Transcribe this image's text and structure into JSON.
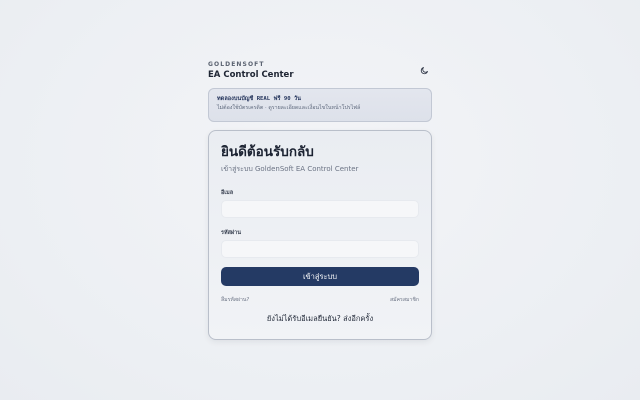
{
  "brand": {
    "company": "GOLDENSOFT",
    "app_name": "EA Control Center"
  },
  "header": {
    "theme_icon": "moon-icon"
  },
  "notice": {
    "title": "ทดลองบนบัญชี REAL ฟรี 90 วัน",
    "text": "ไม่ต้องใช้บัตรเครดิต · ดูรายละเอียดและเงื่อนไขในหน้าโปรไฟล์"
  },
  "login": {
    "title": "ยินดีต้อนรับกลับ",
    "subtitle": "เข้าสู่ระบบ GoldenSoft EA Control Center",
    "email_label": "อีเมล",
    "email_value": "",
    "password_label": "รหัสผ่าน",
    "password_value": "",
    "submit_label": "เข้าสู่ระบบ",
    "forgot_label": "ลืมรหัสผ่าน?",
    "signup_label": "สมัครสมาชิก",
    "resend_label": "ยังไม่ได้รับอีเมลยืนยัน? ส่งอีกครั้ง"
  },
  "colors": {
    "primary": "#243a64",
    "background": "#eef0f4",
    "notice_border": "#c2c8d4"
  }
}
